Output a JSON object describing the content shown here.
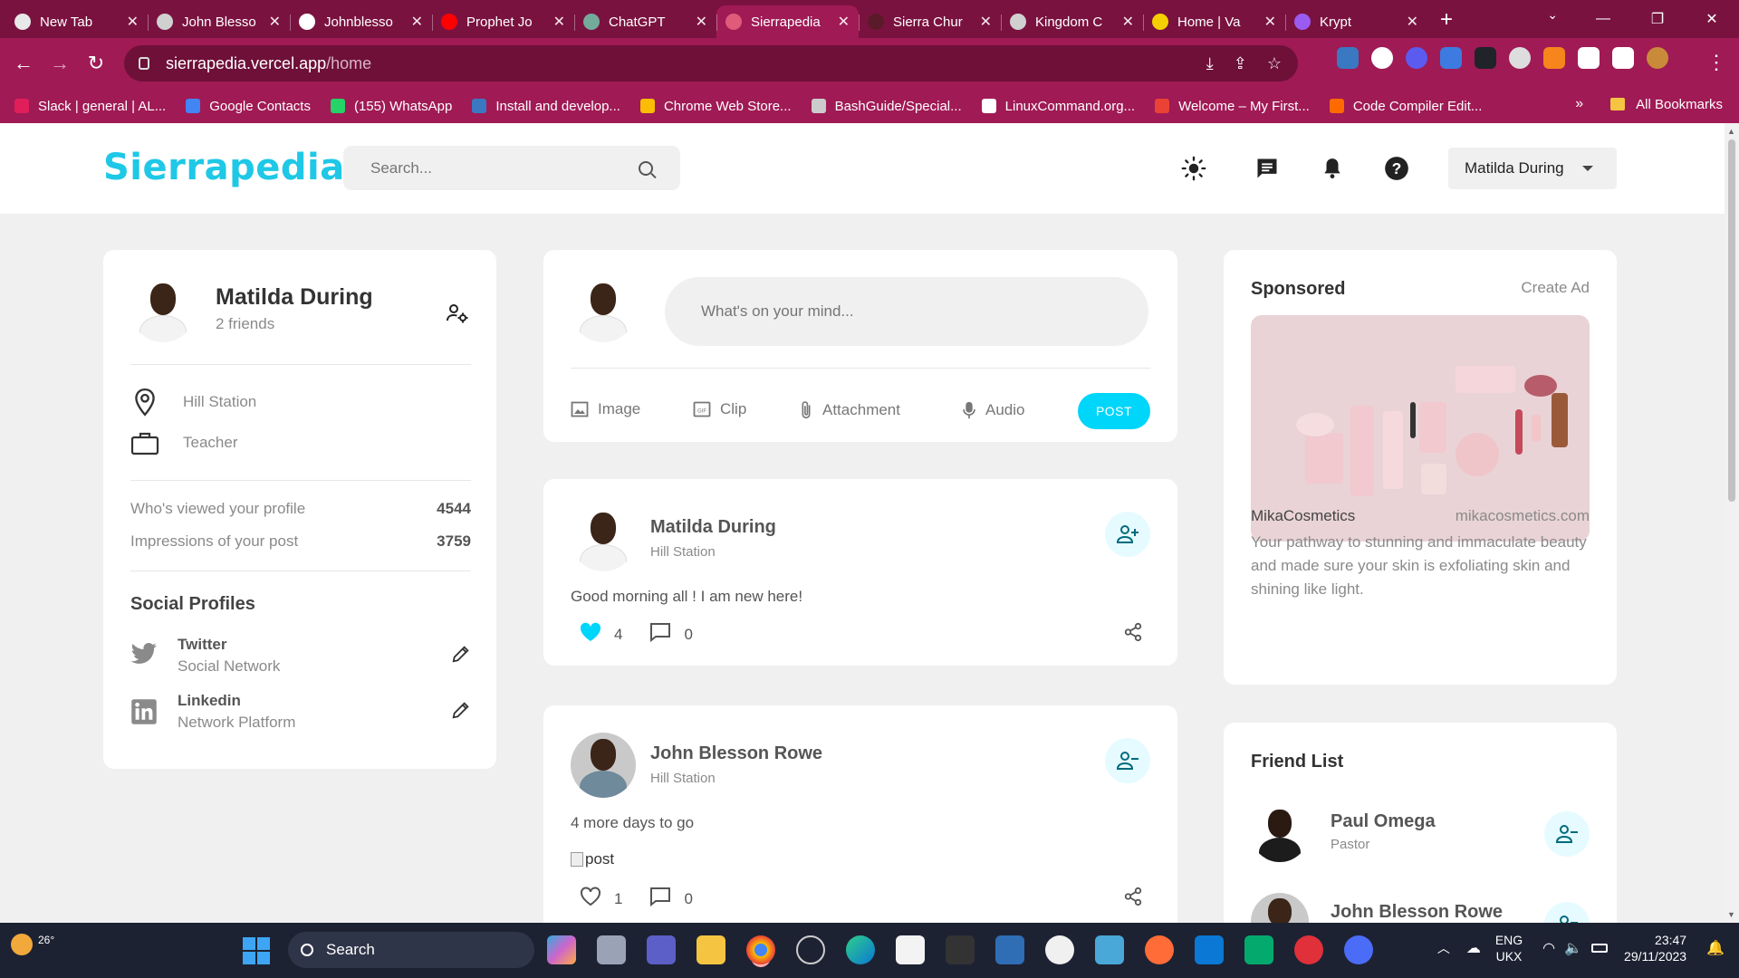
{
  "browser": {
    "tabs": [
      {
        "title": "New Tab",
        "color": "#e8e8e8",
        "active": false
      },
      {
        "title": "John Blesso",
        "color": "#d0d0d0",
        "active": false
      },
      {
        "title": "Johnblesso",
        "color": "#ffffff",
        "active": false
      },
      {
        "title": "Prophet Jo",
        "color": "#ff0000",
        "active": false
      },
      {
        "title": "ChatGPT",
        "color": "#74aa9c",
        "active": false
      },
      {
        "title": "Sierrapedia",
        "color": "#e05a7a",
        "active": true
      },
      {
        "title": "Sierra Chur",
        "color": "#5a1a2a",
        "active": false
      },
      {
        "title": "Kingdom C",
        "color": "#d0d0d0",
        "active": false
      },
      {
        "title": "Home | Va",
        "color": "#f5d000",
        "active": false
      },
      {
        "title": "Krypt",
        "color": "#9a5cf0",
        "active": false
      }
    ],
    "url_host": "sierrapedia.vercel.app",
    "url_path": "/home",
    "bookmarks": [
      {
        "label": "Slack | general | AL...",
        "color": "#e01e5a"
      },
      {
        "label": "Google Contacts",
        "color": "#4285f4"
      },
      {
        "label": "(155) WhatsApp",
        "color": "#25d366"
      },
      {
        "label": "Install and develop...",
        "color": "#3b78c2"
      },
      {
        "label": "Chrome Web Store...",
        "color": "#fbbc05"
      },
      {
        "label": "BashGuide/Special...",
        "color": "#cccccc"
      },
      {
        "label": "LinuxCommand.org...",
        "color": "#ffffff"
      },
      {
        "label": "Welcome – My First...",
        "color": "#ea4335"
      },
      {
        "label": "Code Compiler Edit...",
        "color": "#ff6a00"
      }
    ],
    "all_bookmarks": "All Bookmarks"
  },
  "app": {
    "logo": "Sierrapedia",
    "search_placeholder": "Search...",
    "user_select": "Matilda During"
  },
  "user_widget": {
    "name": "Matilda During",
    "friends": "2 friends",
    "location": "Hill Station",
    "occupation": "Teacher",
    "stats": [
      {
        "label": "Who's viewed your profile",
        "value": "4544"
      },
      {
        "label": "Impressions of your post",
        "value": "3759"
      }
    ],
    "social_title": "Social Profiles",
    "social": [
      {
        "name": "Twitter",
        "type": "Social Network"
      },
      {
        "name": "Linkedin",
        "type": "Network Platform"
      }
    ]
  },
  "composer": {
    "placeholder": "What's on your mind...",
    "actions": [
      "Image",
      "Clip",
      "Attachment",
      "Audio"
    ],
    "post_button": "POST"
  },
  "posts": [
    {
      "name": "Matilda During",
      "location": "Hill Station",
      "text": "Good morning all ! I am new here!",
      "likes": "4",
      "comments": "0",
      "liked": true
    },
    {
      "name": "John Blesson Rowe",
      "location": "Hill Station",
      "text": "4 more days to go",
      "image_alt": "post",
      "likes": "1",
      "comments": "0",
      "liked": false
    }
  ],
  "sponsored": {
    "title": "Sponsored",
    "create_ad": "Create Ad",
    "brand": "MikaCosmetics",
    "site": "mikacosmetics.com",
    "description": "Your pathway to stunning and immaculate beauty and made sure your skin is exfoliating skin and shining like light."
  },
  "friend_list": {
    "title": "Friend List",
    "friends": [
      {
        "name": "Paul Omega",
        "role": "Pastor"
      },
      {
        "name": "John Blesson Rowe",
        "role": ""
      }
    ]
  },
  "taskbar": {
    "temperature": "26°",
    "search": "Search",
    "lang_top": "ENG",
    "lang_bottom": "UKX",
    "time": "23:47",
    "date": "29/11/2023"
  },
  "colors": {
    "accent": "#00d5fa",
    "logo": "#1ec8e6",
    "browser_frame": "#a01a55",
    "liked_heart": "#00d5fa"
  }
}
